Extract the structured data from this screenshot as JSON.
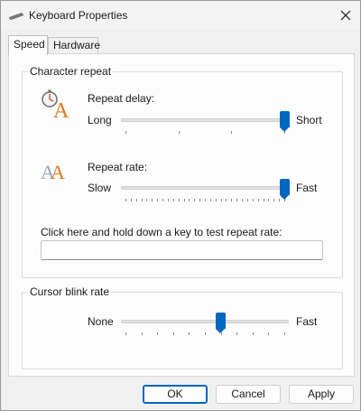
{
  "window": {
    "title": "Keyboard Properties",
    "app_icon": "keyboard-icon",
    "close_icon": "close-icon"
  },
  "tabs": [
    {
      "label": "Speed",
      "active": true
    },
    {
      "label": "Hardware",
      "active": false
    }
  ],
  "character_repeat": {
    "group_label": "Character repeat",
    "repeat_delay": {
      "label": "Repeat delay:",
      "icon": "repeat-delay-icon",
      "min_label": "Long",
      "max_label": "Short",
      "value": 1.0
    },
    "repeat_rate": {
      "label": "Repeat rate:",
      "icon": "repeat-rate-icon",
      "min_label": "Slow",
      "max_label": "Fast",
      "value": 1.0
    },
    "test_label": "Click here and hold down a key to test repeat rate:",
    "test_value": ""
  },
  "cursor_blink": {
    "group_label": "Cursor blink rate",
    "min_label": "None",
    "max_label": "Fast",
    "value": 0.6
  },
  "buttons": {
    "ok": "OK",
    "cancel": "Cancel",
    "apply": "Apply"
  },
  "colors": {
    "accent": "#0067c0"
  }
}
